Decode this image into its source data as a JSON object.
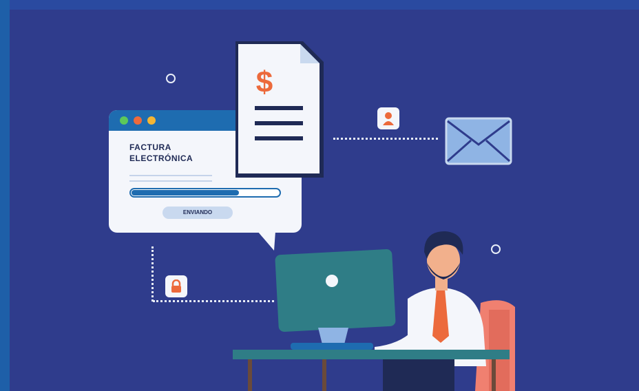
{
  "invoice_window": {
    "title_line1": "FACTURA",
    "title_line2": "ELECTRÓNICA",
    "status_label": "ENVIANDO",
    "progress_fraction": 0.73
  },
  "document": {
    "currency_symbol": "$"
  },
  "colors": {
    "background": "#2f3c8c",
    "accent_blue": "#1e6cb0",
    "accent_orange": "#ec6a3c",
    "card": "#f4f6fb",
    "monitor": "#2f7d86",
    "chair": "#f08070"
  },
  "icons": [
    "envelope-icon",
    "user-icon",
    "lock-icon",
    "dollar-document-icon"
  ]
}
